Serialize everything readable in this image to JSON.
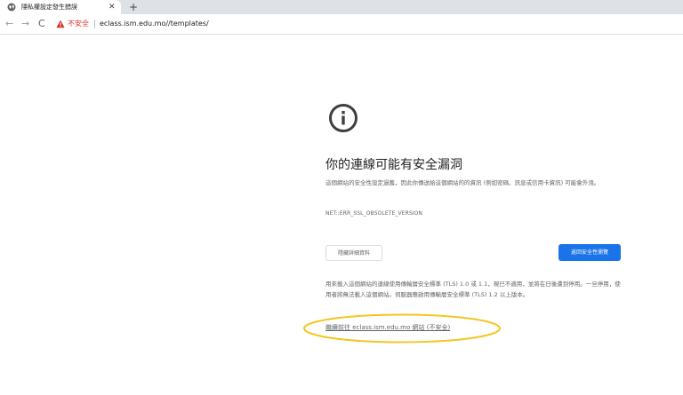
{
  "browser": {
    "tab": {
      "title": "隱私權設定發生錯誤",
      "favicon": "globe-icon",
      "close": "✕"
    },
    "new_tab": "+",
    "nav": {
      "back": "←",
      "forward": "→",
      "reload": "C"
    },
    "omnibox": {
      "security_label": "不安全",
      "url": "eclass.ism.edu.mo//templates/"
    }
  },
  "interstitial": {
    "icon": "info-icon",
    "heading": "你的連線可能有安全漏洞",
    "description": "這個網站的安全性設定過舊，因此你傳送給這個網站的的資訊 (例如密碼、訊息或信用卡資訊) 可能會外洩。",
    "error_code": "NET::ERR_SSL_OBSOLETE_VERSION",
    "hide_details_button": "隱藏詳細資料",
    "back_to_safety_button": "返回安全性瀏覽",
    "details_text": "用來載入這個網站的連線使用傳輸層安全標準 (TLS) 1.0 或 1.1，現已不適用，並將在日後遭到停用。一旦停用，使用者將無法載入這個網站。伺服器應啟用傳輸層安全標準 (TLS) 1.2 以上版本。",
    "proceed_link": "繼續前往 eclass.ism.edu.mo 網站 (不安全)"
  },
  "colors": {
    "primary_button": "#1a73e8",
    "not_secure": "#d93025",
    "highlight": "#f3c623"
  }
}
